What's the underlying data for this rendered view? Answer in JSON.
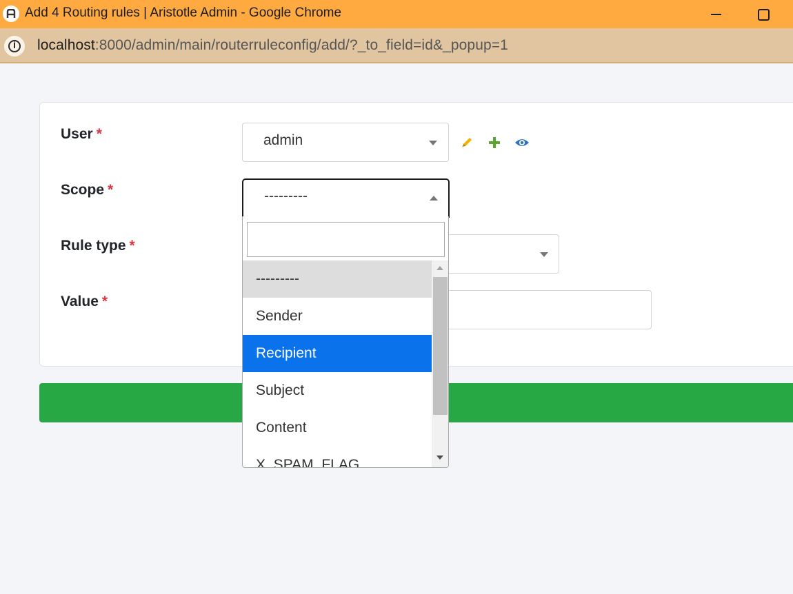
{
  "window": {
    "title": "Add 4 Routing rules | Aristotle Admin - Google Chrome",
    "app_icon": "aristotle-logo-icon",
    "controls": [
      "minimize-icon",
      "maximize-icon"
    ]
  },
  "address_bar": {
    "host": "localhost",
    "path": ":8000/admin/main/routerruleconfig/add/?_to_field=id&_popup=1",
    "site_info_icon": "info-icon"
  },
  "form": {
    "fields": [
      {
        "label": "User",
        "required_marker": "*",
        "value": "admin"
      },
      {
        "label": "Scope",
        "required_marker": "*",
        "value": "---------"
      },
      {
        "label": "Rule type",
        "required_marker": "*",
        "value": ""
      },
      {
        "label": "Value",
        "required_marker": "*",
        "value": ""
      }
    ],
    "user_actions": [
      {
        "icon": "pencil-icon",
        "color": "#f0b400"
      },
      {
        "icon": "plus-icon",
        "color": "#5aa52b"
      },
      {
        "icon": "eye-icon",
        "color": "#2f73bf"
      }
    ],
    "submit_color": "#28a745"
  },
  "scope_dropdown": {
    "search_value": "",
    "options": [
      "---------",
      "Sender",
      "Recipient",
      "Subject",
      "Content",
      "X_SPAM_FLAG"
    ],
    "selected_index": 0,
    "highlighted_index": 2,
    "highlight_color": "#0a73eb"
  }
}
